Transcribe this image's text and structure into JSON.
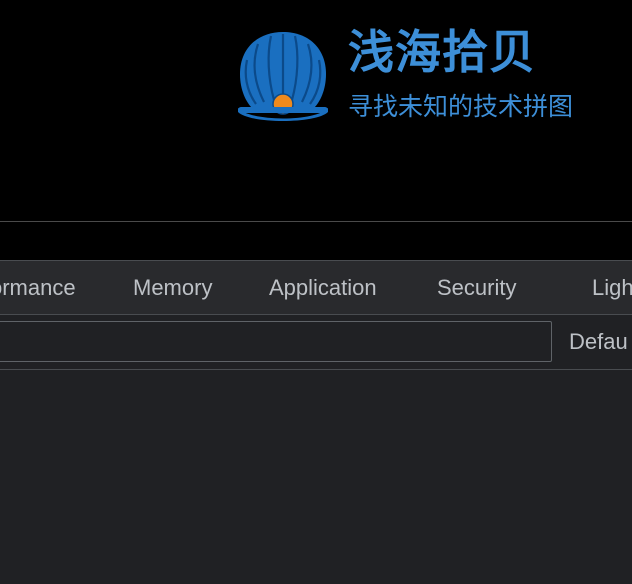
{
  "banner": {
    "title": "浅海拾贝",
    "subtitle": "寻找未知的技术拼图",
    "brand_color": "#3d8fd8",
    "logo_icon": "shell-icon"
  },
  "devtools": {
    "tabs": [
      {
        "label": "ormance"
      },
      {
        "label": "Memory"
      },
      {
        "label": "Application"
      },
      {
        "label": "Security"
      },
      {
        "label": "Ligh"
      }
    ],
    "filter": {
      "value": "",
      "placeholder": ""
    },
    "levels_label": "Defau"
  }
}
